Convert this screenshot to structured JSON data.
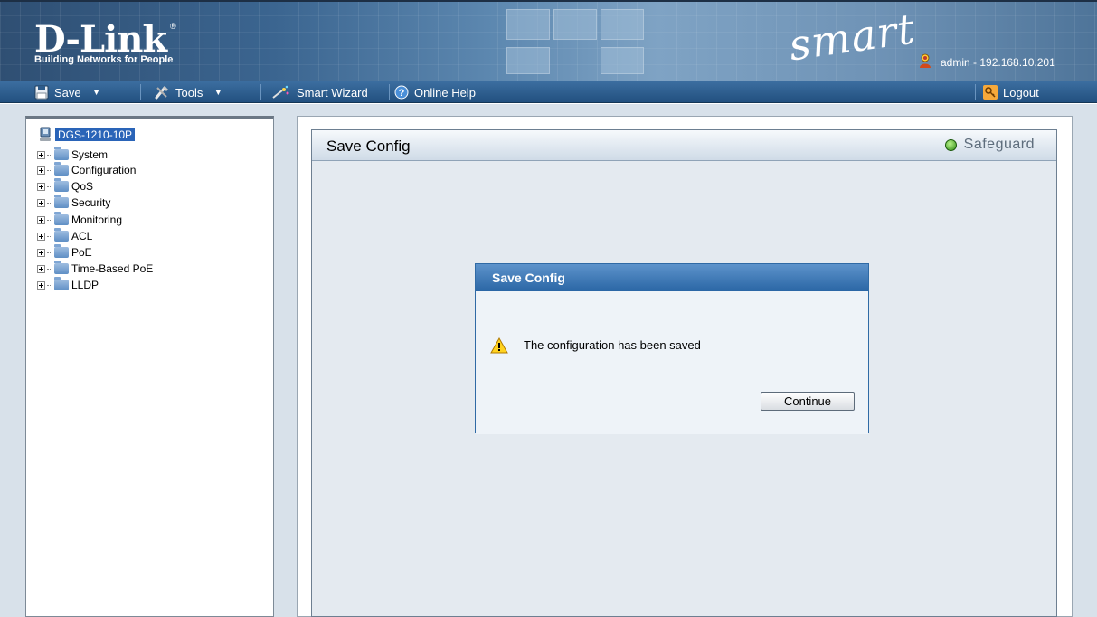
{
  "header": {
    "brand": "D-Link",
    "registered": "®",
    "tagline": "Building Networks for People",
    "product_line": "smart",
    "user": "admin - 192.168.10.201"
  },
  "toolbar": {
    "save_label": "Save",
    "tools_label": "Tools",
    "smart_wizard_label": "Smart Wizard",
    "online_help_label": "Online Help",
    "logout_label": "Logout"
  },
  "tree": {
    "root_label": "DGS-1210-10P",
    "items": [
      {
        "label": "System"
      },
      {
        "label": "Configuration"
      },
      {
        "label": "QoS"
      },
      {
        "label": "Security"
      },
      {
        "label": "Monitoring"
      },
      {
        "label": "ACL"
      },
      {
        "label": "PoE"
      },
      {
        "label": "Time-Based PoE"
      },
      {
        "label": "LLDP"
      }
    ]
  },
  "content": {
    "title": "Save Config",
    "safeguard_label": "Safeguard",
    "safeguard_color": "#3aa11c"
  },
  "dialog": {
    "title": "Save Config",
    "message": "The configuration has been saved",
    "continue_label": "Continue",
    "icon": "warning-icon"
  }
}
